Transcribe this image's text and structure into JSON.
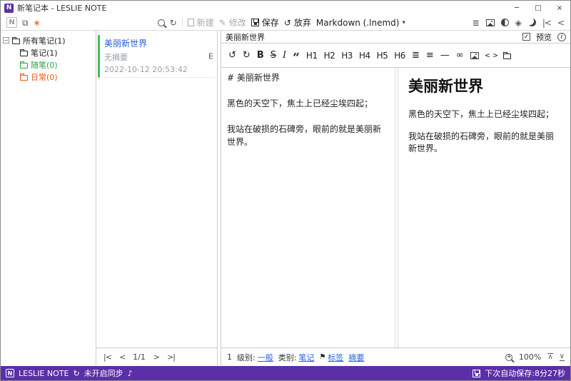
{
  "titlebar": {
    "title": "新笔记本 - LESLIE NOTE"
  },
  "window_controls": {
    "minimize": "─",
    "maximize": "□",
    "close": "×"
  },
  "toolbar": {
    "new_label": "新建",
    "modify_label": "修改",
    "save_label": "保存",
    "discard_label": "放弃",
    "format_value": "Markdown (.lnemd)"
  },
  "sidebar": {
    "items": [
      {
        "label": "所有笔记(1)"
      },
      {
        "label": "笔记(1)"
      },
      {
        "label": "随笔(0)",
        "color": "#2f9e44"
      },
      {
        "label": "日常(0)",
        "color": "#e8590c"
      }
    ]
  },
  "notelist": {
    "note": {
      "title": "美丽新世界",
      "summary": "无摘要",
      "datetime": "2022-10-12 20:53:42",
      "badge": "E",
      "accent_color": "#40c057",
      "title_color": "#2b5bd7"
    },
    "pager": {
      "first": "|<",
      "prev": "<",
      "current": "1/1",
      "next": ">",
      "last": ">|"
    }
  },
  "editor": {
    "title": "美丽新世界",
    "preview_label": "预览",
    "source_lines": [
      "# 美丽新世界",
      "",
      "黑色的天空下，焦土上已经尘埃四起；",
      "",
      "我站在破损的石碑旁，眼前的就是美丽新世界。"
    ],
    "preview": {
      "heading": "美丽新世界",
      "paragraphs": [
        "黑色的天空下，焦土上已经尘埃四起；",
        "我站在破损的石碑旁，眼前的就是美丽新世界。"
      ]
    },
    "footer": {
      "line_number": "1",
      "level_label": "级别:",
      "level_value": "一般",
      "category_label": "类别:",
      "category_value": "笔记",
      "tags_label": "标签",
      "summary_label": "摘要",
      "zoom_value": "100%"
    }
  },
  "statusbar": {
    "app_name": "LESLIE NOTE",
    "sync_status": "未开启同步",
    "autosave_text": "下次自动保存:8分27秒",
    "bg_color": "#5b2fa8"
  },
  "icons": {
    "logo_letter": "N",
    "tree": "⧉",
    "asterisk": "∗",
    "refresh": "↻",
    "sync": "↻",
    "dropdown_caret": "▾",
    "pencil": "✎",
    "undo": "↺",
    "redo": "↻",
    "bold": "B",
    "strikethrough": "S",
    "italic": "I",
    "quote": "“",
    "headings": [
      "H1",
      "H2",
      "H3",
      "H4",
      "H5",
      "H6"
    ],
    "bullet_list": "≣",
    "ordered_list": "≡",
    "horizontal_rule": "—",
    "link": "∞",
    "code": "< >",
    "view_list": "≣",
    "sparkle": "◈",
    "collapse_left": "|<",
    "collapse_right": "<",
    "tree_expander": "−",
    "check": "✓",
    "info": "i",
    "tag_flag": "⚑",
    "scroll_top": "∧",
    "scroll_bottom": "∨",
    "misc": "♪"
  }
}
